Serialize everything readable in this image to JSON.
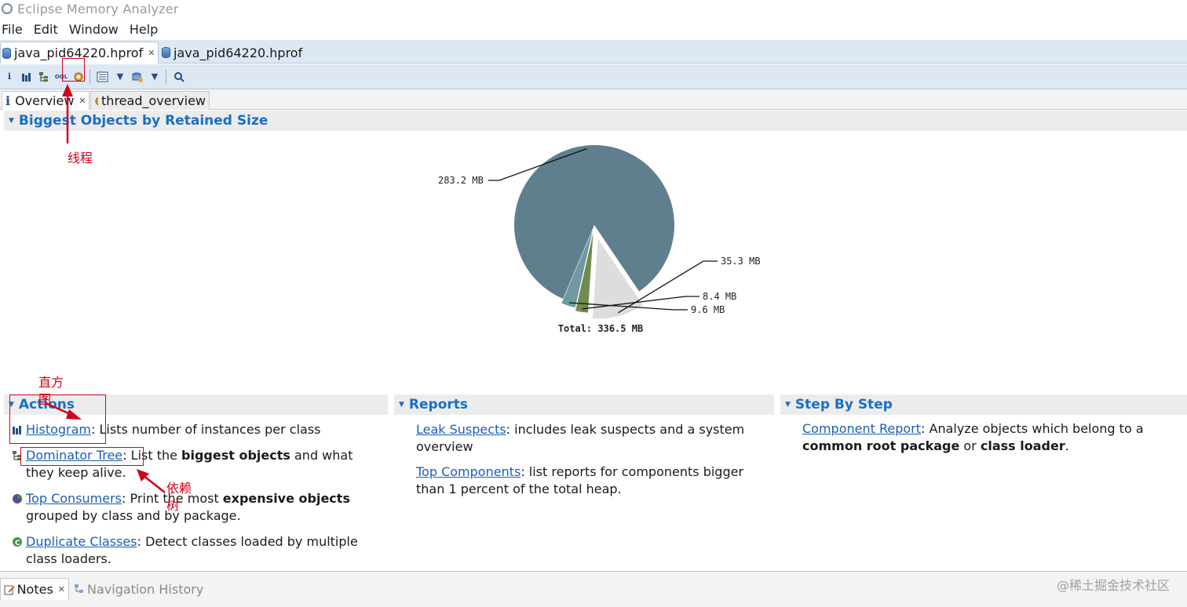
{
  "window": {
    "title": "Eclipse Memory Analyzer"
  },
  "menu": [
    "File",
    "Edit",
    "Window",
    "Help"
  ],
  "editor_tabs": [
    {
      "label": "java_pid64220.hprof",
      "active": true
    },
    {
      "label": "java_pid64220.hprof",
      "active": false
    }
  ],
  "view_tabs": [
    {
      "label": "Overview",
      "active": true
    },
    {
      "label": "thread_overview",
      "active": false
    }
  ],
  "sections": {
    "biggest": "Biggest Objects by Retained Size",
    "actions": "Actions",
    "reports": "Reports",
    "step": "Step By Step"
  },
  "chart_data": {
    "type": "pie",
    "values": [
      283.2,
      35.3,
      8.4,
      9.6
    ],
    "labels": [
      "283.2 MB",
      "35.3 MB",
      "8.4 MB",
      "9.6 MB"
    ],
    "colors": [
      "#5f7f8f",
      "#dddddd",
      "#6f8b4e",
      "#6f9aa0"
    ],
    "total_label": "Total: 336.5 MB"
  },
  "actions": [
    {
      "link": "Histogram",
      "text": ": Lists number of instances per class",
      "icon": "histogram-icon"
    },
    {
      "link": "Dominator Tree",
      "text_a": ": List the ",
      "bold_a": "biggest objects",
      "text_b": " and what they keep alive.",
      "icon": "dominator-tree-icon"
    },
    {
      "link": "Top Consumers",
      "text_a": ": Print the most ",
      "bold_a": "expensive objects",
      "text_b": " grouped by class and by package.",
      "icon": "top-consumers-icon"
    },
    {
      "link": "Duplicate Classes",
      "text": ": Detect classes loaded by multiple class loaders.",
      "icon": "duplicate-classes-icon"
    }
  ],
  "reports": [
    {
      "link": "Leak Suspects",
      "text": ": includes leak suspects and a system overview"
    },
    {
      "link": "Top Components",
      "text": ": list reports for components bigger than 1 percent of the total heap."
    }
  ],
  "steps": [
    {
      "link": "Component Report",
      "text_a": ": Analyze objects which belong to a ",
      "bold_a": "common root package",
      "text_b": " or ",
      "bold_b": "class loader",
      "text_c": "."
    }
  ],
  "annotations": {
    "thread": "线程",
    "histogram": "直方图",
    "dominator": "依赖树"
  },
  "bottom_tabs": [
    {
      "label": "Notes",
      "active": true
    },
    {
      "label": "Navigation History",
      "active": false
    }
  ],
  "watermark": "@稀土掘金技术社区"
}
